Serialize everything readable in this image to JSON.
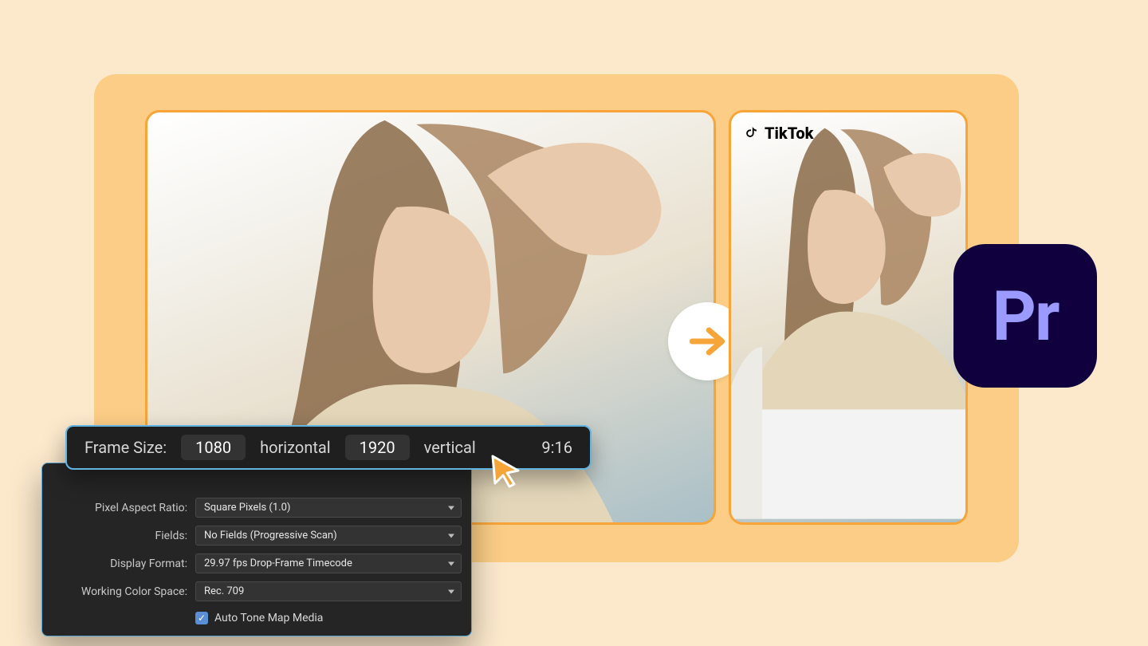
{
  "tiktok": {
    "label": "TikTok"
  },
  "app": {
    "short": "Pr"
  },
  "frame_bar": {
    "label": "Frame Size:",
    "width": "1080",
    "word_h": "horizontal",
    "height": "1920",
    "word_v": "vertical",
    "ratio": "9:16"
  },
  "settings": {
    "pixel_aspect_ratio": {
      "label": "Pixel Aspect Ratio:",
      "value": "Square Pixels (1.0)"
    },
    "fields": {
      "label": "Fields:",
      "value": "No Fields (Progressive Scan)"
    },
    "display_format": {
      "label": "Display Format:",
      "value": "29.97 fps Drop-Frame Timecode"
    },
    "working_color_space": {
      "label": "Working Color Space:",
      "value": "Rec. 709"
    },
    "auto_tone_map": {
      "label": "Auto Tone Map Media",
      "checked": true
    }
  }
}
